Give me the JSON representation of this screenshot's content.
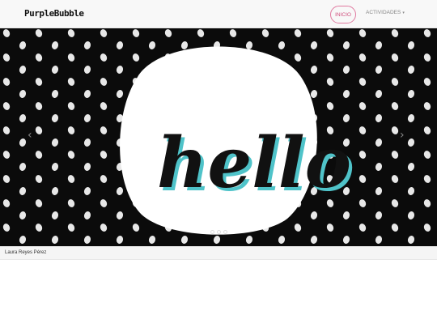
{
  "navbar": {
    "brand": "PurpleBubble",
    "home_label": "INICIO",
    "activities_label": "ACTIVIDADES",
    "caret_icon": "caret-down-icon"
  },
  "carousel": {
    "slide_text": "hello",
    "indicator_count": 3,
    "active_index": 0,
    "prev_icon": "chevron-left-icon",
    "next_icon": "chevron-right-icon"
  },
  "footer": {
    "author": "Laura Reyes Pérez"
  },
  "colors": {
    "accent": "#d0507e",
    "carousel_bg": "#0b0b0b",
    "script_shadow": "#4fc3c9"
  }
}
